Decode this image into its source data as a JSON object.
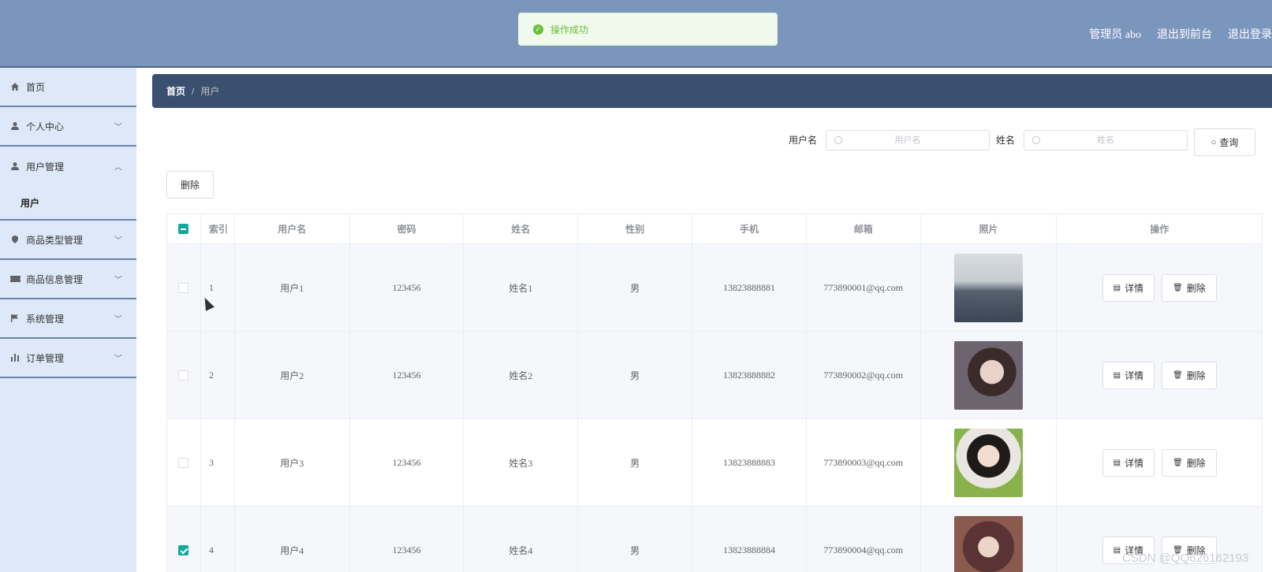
{
  "header": {
    "admin_label": "管理员 abo",
    "back_label": "退出到前台",
    "logout_label": "退出登录"
  },
  "toast": {
    "message": "操作成功"
  },
  "sidebar": {
    "items": [
      {
        "label": "首页",
        "icon": "home-icon"
      },
      {
        "label": "个人中心",
        "icon": "user-icon"
      },
      {
        "label": "用户管理",
        "icon": "user-icon"
      },
      {
        "label": "商品类型管理",
        "icon": "location-icon"
      },
      {
        "label": "商品信息管理",
        "icon": "ticket-icon"
      },
      {
        "label": "系统管理",
        "icon": "flag-icon"
      },
      {
        "label": "订单管理",
        "icon": "chart-icon"
      }
    ],
    "sub_item": "用户"
  },
  "breadcrumb": {
    "home": "首页",
    "current": "用户"
  },
  "search": {
    "username_label": "用户名",
    "username_placeholder": "用户名",
    "name_label": "姓名",
    "name_placeholder": "姓名",
    "query_label": "查询"
  },
  "toolbar": {
    "delete_label": "删除"
  },
  "table": {
    "headers": [
      "索引",
      "用户名",
      "密码",
      "姓名",
      "性别",
      "手机",
      "邮箱",
      "照片",
      "操作"
    ],
    "detail_label": "详情",
    "delete_label": "删除",
    "rows": [
      {
        "index": "1",
        "username": "用户1",
        "password": "123456",
        "name": "姓名1",
        "gender": "男",
        "phone": "13823888881",
        "email": "773890001@qq.com",
        "checked": false
      },
      {
        "index": "2",
        "username": "用户2",
        "password": "123456",
        "name": "姓名2",
        "gender": "男",
        "phone": "13823888882",
        "email": "773890002@qq.com",
        "checked": false
      },
      {
        "index": "3",
        "username": "用户3",
        "password": "123456",
        "name": "姓名3",
        "gender": "男",
        "phone": "13823888883",
        "email": "773890003@qq.com",
        "checked": false
      },
      {
        "index": "4",
        "username": "用户4",
        "password": "123456",
        "name": "姓名4",
        "gender": "男",
        "phone": "13823888884",
        "email": "773890004@qq.com",
        "checked": true
      }
    ]
  },
  "watermark": "CSDN @QQ626162193",
  "colors": {
    "accent": "#13a89e",
    "header_bg": "#7b96bd",
    "crumb_bg": "#3b4f6e",
    "sidebar_bg": "#dde9f8"
  }
}
